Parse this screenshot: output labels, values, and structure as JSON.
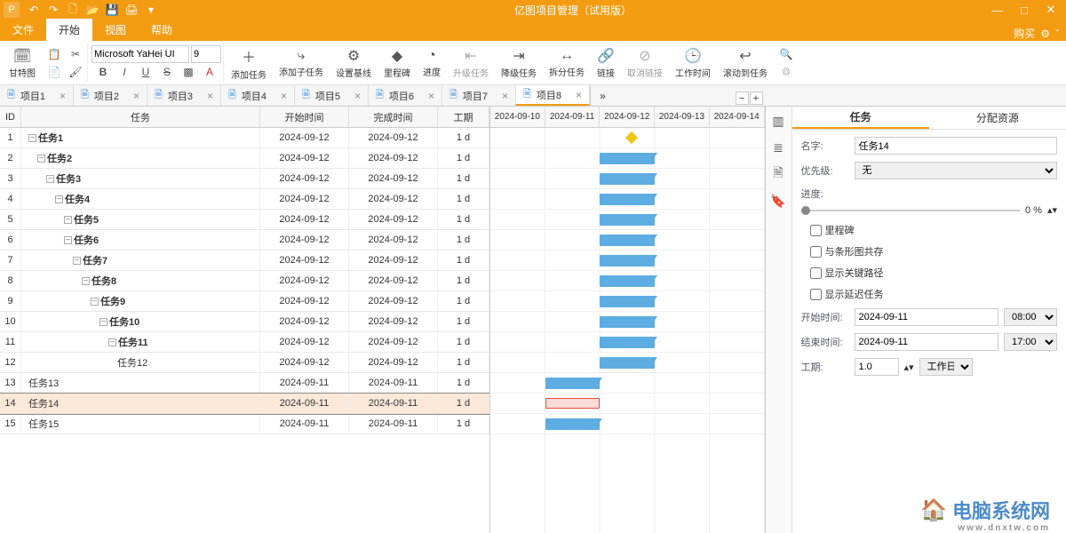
{
  "app": {
    "title": "亿图项目管理（试用版）"
  },
  "menu": {
    "tabs": [
      "文件",
      "开始",
      "视图",
      "帮助"
    ],
    "buy": "购买"
  },
  "ribbon": {
    "gantt": "甘特图",
    "font_name": "Microsoft YaHei UI",
    "font_size": "9",
    "add_task": "添加任务",
    "add_subtask": "添加子任务",
    "baseline": "设置基线",
    "milestone": "里程碑",
    "progress": "进度",
    "promote": "升级任务",
    "demote": "降级任务",
    "split": "拆分任务",
    "link": "链接",
    "unlink": "取消链接",
    "worktime": "工作时间",
    "scrollto": "滚动到任务"
  },
  "doc_tabs": [
    "项目1",
    "项目2",
    "项目3",
    "项目4",
    "项目5",
    "项目6",
    "项目7",
    "项目8"
  ],
  "columns": {
    "id": "ID",
    "task": "任务",
    "start": "开始时间",
    "end": "完成时间",
    "dur": "工期"
  },
  "tasks": [
    {
      "id": 1,
      "name": "任务1",
      "indent": 0,
      "start": "2024-09-12",
      "end": "2024-09-12",
      "dur": "1 d",
      "exp": true,
      "leaf": false
    },
    {
      "id": 2,
      "name": "任务2",
      "indent": 1,
      "start": "2024-09-12",
      "end": "2024-09-12",
      "dur": "1 d",
      "exp": true,
      "leaf": false
    },
    {
      "id": 3,
      "name": "任务3",
      "indent": 2,
      "start": "2024-09-12",
      "end": "2024-09-12",
      "dur": "1 d",
      "exp": true,
      "leaf": false
    },
    {
      "id": 4,
      "name": "任务4",
      "indent": 3,
      "start": "2024-09-12",
      "end": "2024-09-12",
      "dur": "1 d",
      "exp": true,
      "leaf": false
    },
    {
      "id": 5,
      "name": "任务5",
      "indent": 4,
      "start": "2024-09-12",
      "end": "2024-09-12",
      "dur": "1 d",
      "exp": true,
      "leaf": false
    },
    {
      "id": 6,
      "name": "任务6",
      "indent": 4,
      "start": "2024-09-12",
      "end": "2024-09-12",
      "dur": "1 d",
      "exp": true,
      "leaf": false
    },
    {
      "id": 7,
      "name": "任务7",
      "indent": 5,
      "start": "2024-09-12",
      "end": "2024-09-12",
      "dur": "1 d",
      "exp": true,
      "leaf": false
    },
    {
      "id": 8,
      "name": "任务8",
      "indent": 6,
      "start": "2024-09-12",
      "end": "2024-09-12",
      "dur": "1 d",
      "exp": true,
      "leaf": false
    },
    {
      "id": 9,
      "name": "任务9",
      "indent": 7,
      "start": "2024-09-12",
      "end": "2024-09-12",
      "dur": "1 d",
      "exp": true,
      "leaf": false
    },
    {
      "id": 10,
      "name": "任务10",
      "indent": 8,
      "start": "2024-09-12",
      "end": "2024-09-12",
      "dur": "1 d",
      "exp": true,
      "leaf": false
    },
    {
      "id": 11,
      "name": "任务11",
      "indent": 9,
      "start": "2024-09-12",
      "end": "2024-09-12",
      "dur": "1 d",
      "exp": true,
      "leaf": false
    },
    {
      "id": 12,
      "name": "任务12",
      "indent": 10,
      "start": "2024-09-12",
      "end": "2024-09-12",
      "dur": "1 d",
      "exp": false,
      "leaf": true
    },
    {
      "id": 13,
      "name": "任务13",
      "indent": 0,
      "start": "2024-09-11",
      "end": "2024-09-11",
      "dur": "1 d",
      "exp": false,
      "leaf": true
    },
    {
      "id": 14,
      "name": "任务14",
      "indent": 0,
      "start": "2024-09-11",
      "end": "2024-09-11",
      "dur": "1 d",
      "exp": false,
      "leaf": true,
      "selected": true
    },
    {
      "id": 15,
      "name": "任务15",
      "indent": 0,
      "start": "2024-09-11",
      "end": "2024-09-11",
      "dur": "1 d",
      "exp": false,
      "leaf": true
    }
  ],
  "timeline": [
    "2024-09-10",
    "2024-09-11",
    "2024-09-12",
    "2024-09-13",
    "2024-09-14"
  ],
  "gantt": [
    {
      "type": "diamond",
      "col": 2
    },
    {
      "type": "bar",
      "col": 2
    },
    {
      "type": "bar",
      "col": 2
    },
    {
      "type": "bar",
      "col": 2
    },
    {
      "type": "bar",
      "col": 2
    },
    {
      "type": "bar",
      "col": 2
    },
    {
      "type": "bar",
      "col": 2
    },
    {
      "type": "bar",
      "col": 2
    },
    {
      "type": "bar",
      "col": 2
    },
    {
      "type": "bar",
      "col": 2
    },
    {
      "type": "bar",
      "col": 2
    },
    {
      "type": "bar",
      "col": 2
    },
    {
      "type": "bar",
      "col": 1
    },
    {
      "type": "sel",
      "col": 1
    },
    {
      "type": "bar",
      "col": 1
    }
  ],
  "panel": {
    "tab_task": "任务",
    "tab_assign": "分配资源",
    "name_lbl": "名字:",
    "name_val": "任务14",
    "prio_lbl": "优先级:",
    "prio_val": "无",
    "prog_lbl": "进度:",
    "prog_val": "0 %",
    "chk_milestone": "里程碑",
    "chk_bar": "与条形图共存",
    "chk_critical": "显示关键路径",
    "chk_delay": "显示延迟任务",
    "start_lbl": "开始时间:",
    "start_date": "2024-09-11",
    "start_time": "08:00",
    "end_lbl": "结束时间:",
    "end_date": "2024-09-11",
    "end_time": "17:00",
    "dur_lbl": "工期:",
    "dur_val": "1.0",
    "dur_unit": "工作日"
  },
  "watermark": {
    "text": "电脑系统网",
    "sub": "www.dnxtw.com"
  }
}
